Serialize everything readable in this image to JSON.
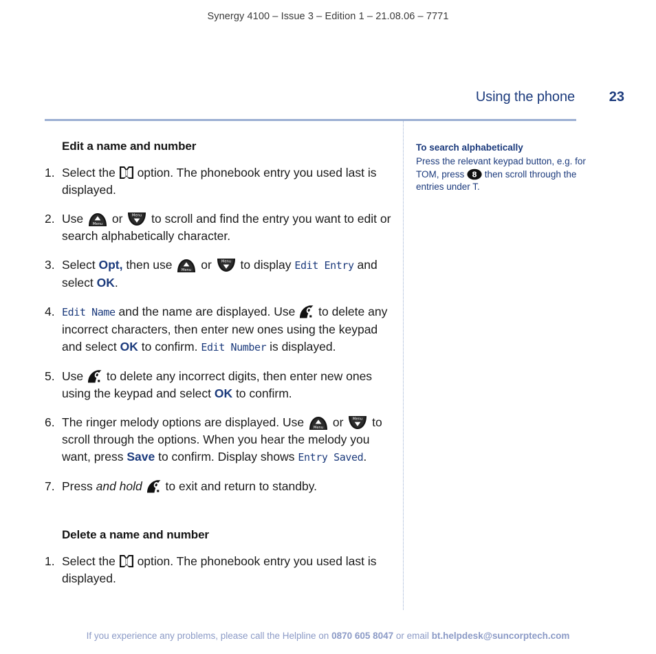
{
  "document": {
    "running_head": "Synergy 4100 – Issue 3 – Edition 1 – 21.08.06 – 7771",
    "section_title": "Using the phone",
    "page_number": "23",
    "colors": {
      "navy": "#1b3a7c",
      "rule": "#9aaed2",
      "footer": "#8b9ac6",
      "body_text": "#1a1a1a"
    }
  },
  "main": {
    "heading_edit": "Edit a name and number",
    "heading_delete": "Delete a name and number",
    "edit_steps": [
      {
        "num": "1.",
        "parts": [
          {
            "t": "text",
            "v": "Select the "
          },
          {
            "t": "icon",
            "v": "phonebook-icon"
          },
          {
            "t": "text",
            "v": " option. The phonebook entry you used last is displayed."
          }
        ]
      },
      {
        "num": "2.",
        "parts": [
          {
            "t": "text",
            "v": "Use "
          },
          {
            "t": "icon",
            "v": "menu-up-icon"
          },
          {
            "t": "text",
            "v": " or "
          },
          {
            "t": "icon",
            "v": "menu-down-icon"
          },
          {
            "t": "text",
            "v": " to scroll and find the entry you want to edit or search alphabetically character."
          }
        ]
      },
      {
        "num": "3.",
        "parts": [
          {
            "t": "text",
            "v": "Select "
          },
          {
            "t": "softkey",
            "v": "Opt,"
          },
          {
            "t": "text",
            "v": " then use "
          },
          {
            "t": "icon",
            "v": "menu-up-icon"
          },
          {
            "t": "text",
            "v": " or "
          },
          {
            "t": "icon",
            "v": "menu-down-icon"
          },
          {
            "t": "text",
            "v": " to display "
          },
          {
            "t": "lcd",
            "v": "Edit Entry"
          },
          {
            "t": "text",
            "v": " and select "
          },
          {
            "t": "softkey",
            "v": "OK"
          },
          {
            "t": "text",
            "v": "."
          }
        ]
      },
      {
        "num": "4.",
        "parts": [
          {
            "t": "lcd",
            "v": "Edit Name"
          },
          {
            "t": "text",
            "v": " and the name are displayed. Use "
          },
          {
            "t": "icon",
            "v": "hangup-icon"
          },
          {
            "t": "text",
            "v": " to delete any incorrect characters, then enter new ones using the keypad and select "
          },
          {
            "t": "softkey",
            "v": "OK"
          },
          {
            "t": "text",
            "v": " to confirm. "
          },
          {
            "t": "lcd",
            "v": "Edit Number"
          },
          {
            "t": "text",
            "v": " is displayed."
          }
        ]
      },
      {
        "num": "5.",
        "parts": [
          {
            "t": "text",
            "v": "Use "
          },
          {
            "t": "icon",
            "v": "hangup-icon"
          },
          {
            "t": "text",
            "v": " to delete any incorrect digits, then enter new ones using the keypad and select "
          },
          {
            "t": "softkey",
            "v": "OK"
          },
          {
            "t": "text",
            "v": " to confirm."
          }
        ]
      },
      {
        "num": "6.",
        "parts": [
          {
            "t": "text",
            "v": "The ringer melody options are displayed. Use "
          },
          {
            "t": "icon",
            "v": "menu-up-icon"
          },
          {
            "t": "text",
            "v": " or "
          },
          {
            "t": "icon",
            "v": "menu-down-icon"
          },
          {
            "t": "text",
            "v": " to scroll through the options. When you hear the melody you want, press "
          },
          {
            "t": "softkey",
            "v": "Save"
          },
          {
            "t": "text",
            "v": " to confirm. Display shows "
          },
          {
            "t": "lcd",
            "v": "Entry Saved"
          },
          {
            "t": "text",
            "v": "."
          }
        ]
      },
      {
        "num": "7.",
        "parts": [
          {
            "t": "text",
            "v": "Press "
          },
          {
            "t": "italic",
            "v": "and hold"
          },
          {
            "t": "text",
            "v": " "
          },
          {
            "t": "icon",
            "v": "hangup-icon"
          },
          {
            "t": "text",
            "v": " to exit and return to standby."
          }
        ]
      }
    ],
    "delete_steps": [
      {
        "num": "1.",
        "parts": [
          {
            "t": "text",
            "v": "Select the "
          },
          {
            "t": "icon",
            "v": "phonebook-icon"
          },
          {
            "t": "text",
            "v": " option. The phonebook entry you used last is displayed."
          }
        ]
      }
    ]
  },
  "sidebar": {
    "heading": "To search alphabetically",
    "parts": [
      {
        "t": "text",
        "v": "Press the relevant keypad button, e.g. for TOM, press "
      },
      {
        "t": "icon",
        "v": "keypad-8-icon"
      },
      {
        "t": "text",
        "v": " then scroll through the entries under T."
      }
    ]
  },
  "footer": {
    "lead": "If you experience any problems, please call the Helpline on ",
    "phone": "0870 605 8047",
    "mid": " or email ",
    "email": "bt.helpdesk@suncorptech.com"
  }
}
